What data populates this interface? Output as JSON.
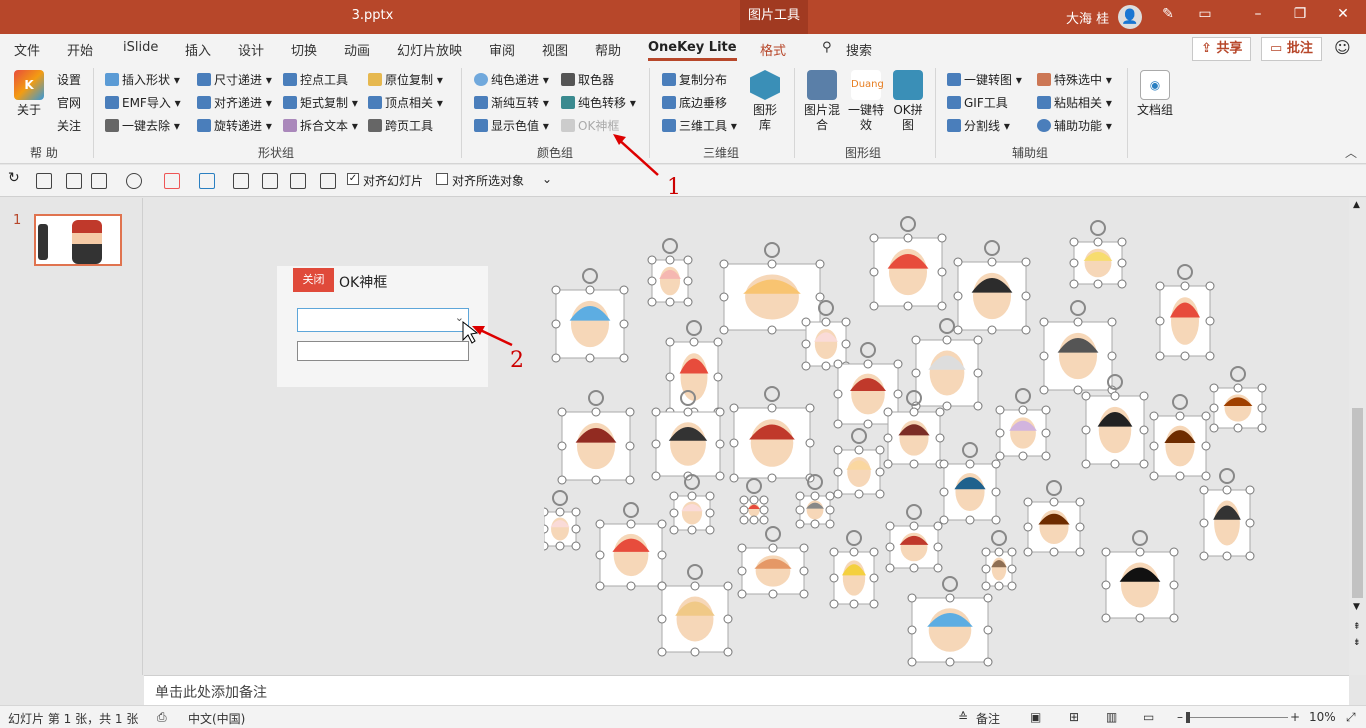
{
  "window": {
    "title": "3.pptx",
    "context_tab": "图片工具",
    "user": "大海 桂"
  },
  "tabs": [
    "文件",
    "开始",
    "iSlide",
    "插入",
    "设计",
    "切换",
    "动画",
    "幻灯片放映",
    "审阅",
    "视图",
    "帮助",
    "OneKey Lite",
    "格式"
  ],
  "search_label": "搜索",
  "share_label": "共享",
  "comment_label": "批注",
  "ribbon": {
    "help_group": {
      "label": "帮 助",
      "about": "关于",
      "settings": "设置",
      "website": "官网",
      "follow": "关注"
    },
    "shape_group": {
      "label": "形状组",
      "items": [
        "插入形状",
        "EMF导入",
        "一键去除",
        "尺寸递进",
        "对齐递进",
        "旋转递进",
        "控点工具",
        "矩式复制",
        "拆合文本",
        "原位复制",
        "顶点相关",
        "跨页工具"
      ]
    },
    "color_group": {
      "label": "颜色组",
      "items": [
        "纯色递进",
        "渐纯互转",
        "显示色值",
        "取色器",
        "纯色转移",
        "OK神框"
      ]
    },
    "three_d_group": {
      "label": "三维组",
      "items": [
        "复制分布",
        "底边垂移",
        "三维工具"
      ],
      "big": "图形库"
    },
    "graphic_group": {
      "label": "图形组",
      "items": [
        "图片混合",
        "一键特效",
        "OK拼图"
      ]
    },
    "assist_group": {
      "label": "辅助组",
      "items": [
        "一键转图",
        "GIF工具",
        "分割线",
        "特殊选中",
        "粘贴相关",
        "辅助功能"
      ]
    },
    "doc_group": {
      "item": "文档组"
    }
  },
  "quick_toolbar": {
    "align_slide": "对齐幻灯片",
    "align_selected": "对齐所选对象"
  },
  "thumbnail": {
    "number": "1"
  },
  "dialog": {
    "close_label": "关闭",
    "title": "OK神框"
  },
  "annotations": {
    "one": "1",
    "two": "2"
  },
  "notes_placeholder": "单击此处添加备注",
  "status": {
    "slide_info": "幻灯片 第 1 张，共 1 张",
    "language": "中文(中国)",
    "notes": "备注",
    "zoom": "10%"
  }
}
